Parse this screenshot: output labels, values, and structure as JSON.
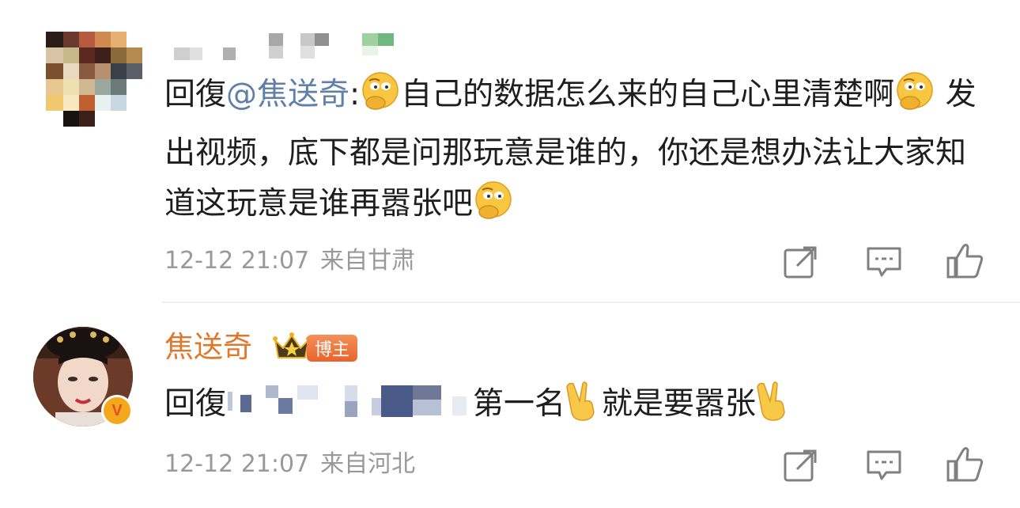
{
  "comments": [
    {
      "reply_prefix": "回復",
      "mention": "@焦送奇",
      "mention_colon": ":",
      "text_part1": "自己的数据怎么来的自己心里清楚啊",
      "text_part2": " 发出视频，底下都是问那玩意是谁的，你还是想办法让大家知道这玩意是谁再嚣张吧",
      "time": "12-12 21:07",
      "location": "来自甘肃",
      "emoji": "thinking-face"
    },
    {
      "username": "焦送奇",
      "badge_label": "博主",
      "verified_label": "V",
      "reply_prefix": "回復",
      "text_part1": "第一名",
      "text_part2": "就是要嚣张",
      "time": "12-12 21:07",
      "location": "来自河北",
      "emoji": "victory-hand"
    }
  ],
  "actions": [
    "share-icon",
    "comment-icon",
    "like-icon"
  ],
  "colors": {
    "username": "#e0772a",
    "mention": "#5f7fa8",
    "meta": "#999999",
    "action": "#808080"
  }
}
